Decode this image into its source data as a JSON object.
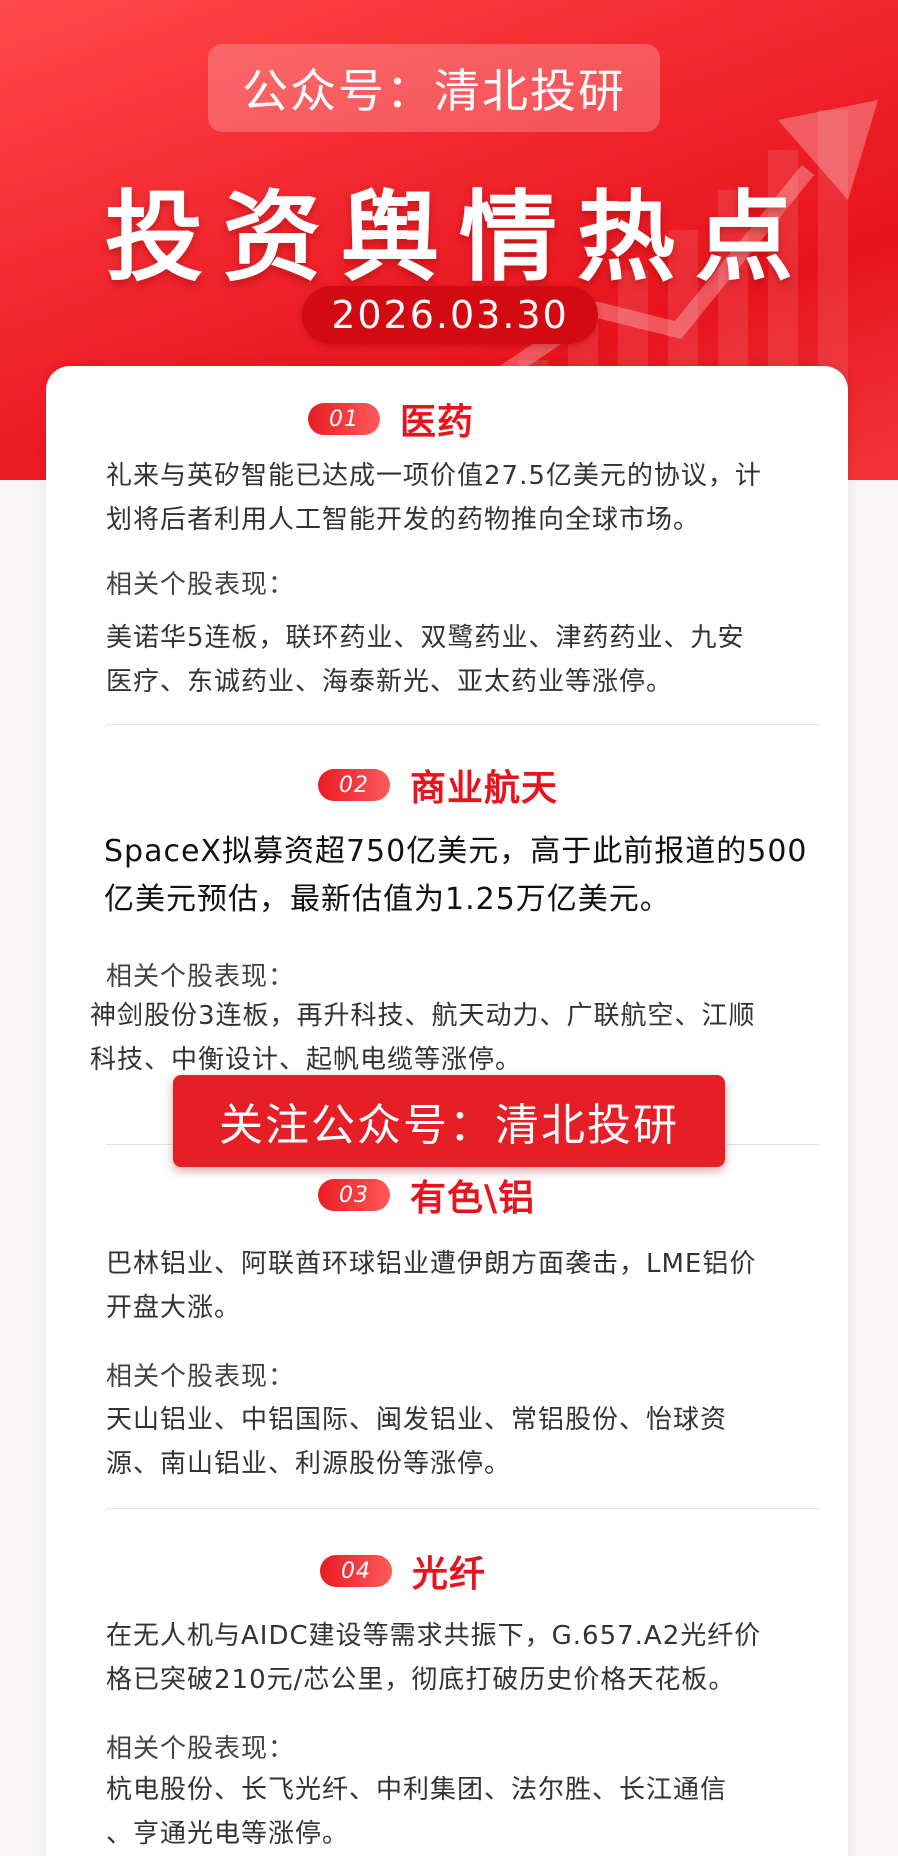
{
  "header": {
    "account": "公众号：清北投研",
    "title": "投资舆情热点",
    "date": "2026.03.30"
  },
  "sections": [
    {
      "num": "01",
      "title": "医药",
      "lines": [
        "礼来与英矽智能已达成一项价值27.5亿美元的协议，计",
        "划将后者利用人工智能开发的药物推向全球市场。"
      ],
      "stock_label": "相关个股表现：",
      "stocks": [
        "美诺华5连板，联环药业、双鹭药业、津药药业、九安",
        "医疗、东诚药业、海泰新光、亚太药业等涨停。"
      ]
    },
    {
      "num": "02",
      "title": "商业航天",
      "lines": [
        "SpaceX拟募资超750亿美元，高于此前报道的500",
        "亿美元预估，最新估值为1.25万亿美元。"
      ],
      "stock_label": "相关个股表现：",
      "stocks": [
        "神剑股份3连板，再升科技、航天动力、广联航空、江顺",
        "科技、中衡设计、起帆电缆等涨停。"
      ]
    },
    {
      "num": "03",
      "title": "有色\\铝",
      "lines": [
        "巴林铝业、阿联酋环球铝业遭伊朗方面袭击，LME铝价",
        "开盘大涨。"
      ],
      "stock_label": "相关个股表现：",
      "stocks": [
        "天山铝业、中铝国际、闽发铝业、常铝股份、怡球资",
        "源、南山铝业、利源股份等涨停。"
      ]
    },
    {
      "num": "04",
      "title": "光纤",
      "lines": [
        "在无人机与AIDC建设等需求共振下，G.657.A2光纤价",
        "格已突破210元/芯公里，彻底打破历史价格天花板。"
      ],
      "stock_label": "相关个股表现：",
      "stocks": [
        "杭电股份、长飞光纤、中利集团、法尔胜、长江通信",
        "、亨通光电等涨停。"
      ]
    }
  ],
  "follow_banner": "关注公众号：清北投研",
  "colors": {
    "accent": "#e8141d",
    "header_bg": "#f0222a"
  }
}
